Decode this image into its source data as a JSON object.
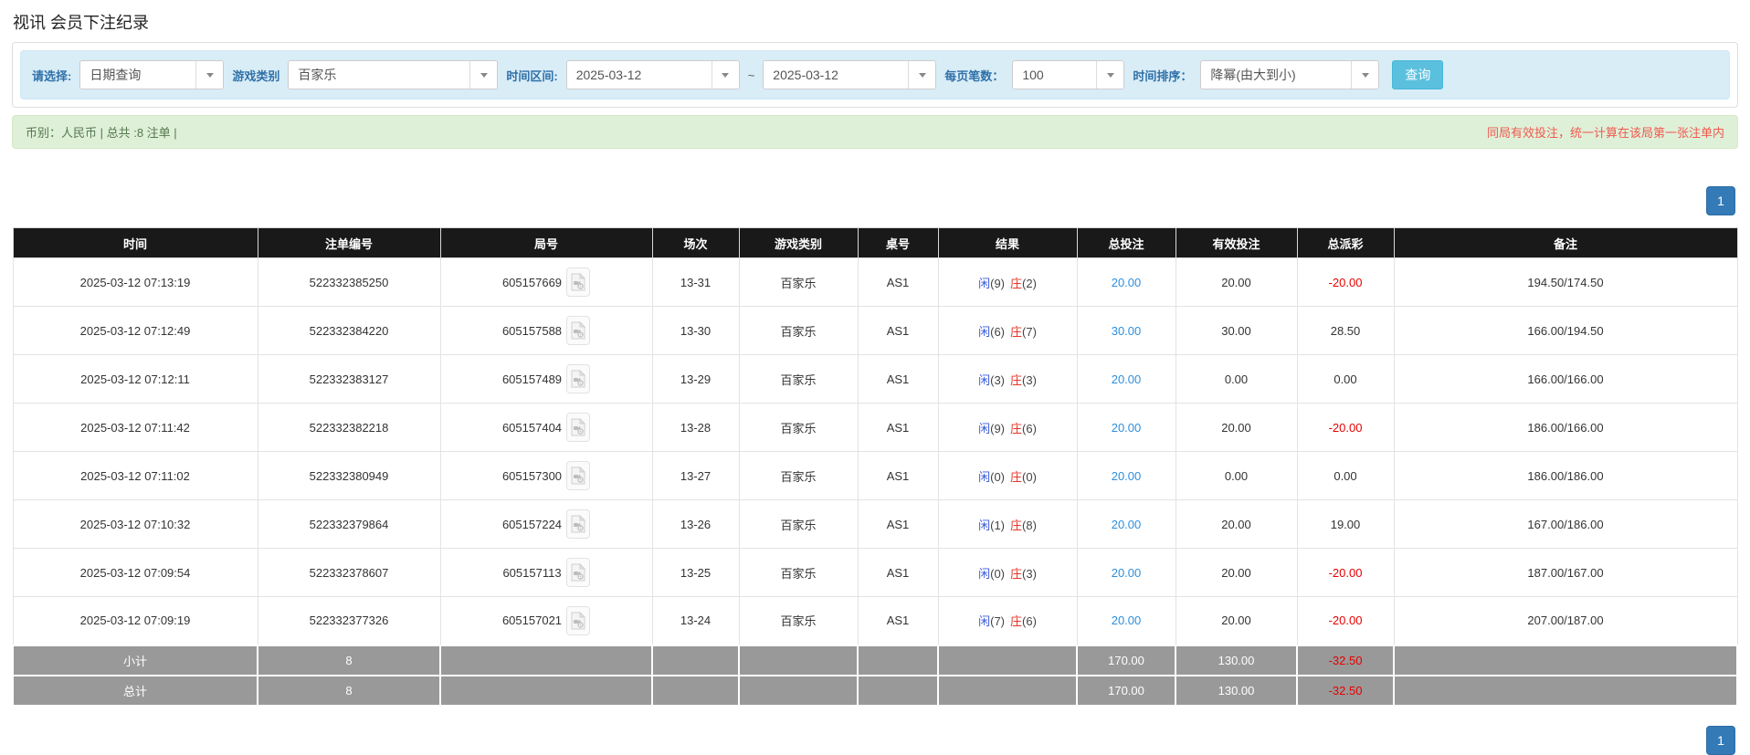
{
  "page": {
    "title": "视讯 会员下注纪录"
  },
  "filters": {
    "select": {
      "label": "请选择:",
      "value": "日期查询"
    },
    "game_type": {
      "label": "游戏类别",
      "value": "百家乐"
    },
    "time_range": {
      "label": "时间区间:",
      "from": "2025-03-12",
      "separator": "~",
      "to": "2025-03-12"
    },
    "page_size": {
      "label": "每页笔数：",
      "value": "100"
    },
    "time_sort": {
      "label": "时间排序：",
      "value": "降幂(由大到小)"
    },
    "search_button": "查询"
  },
  "summary": {
    "currency_total": "币别：人民币 | 总共 :8 注单 |",
    "note": "同局有效投注，统一计算在该局第一张注单内"
  },
  "pagination": {
    "current_page": "1"
  },
  "icons": {
    "dropdown": "chevron-down-icon",
    "round_video": "video-file-icon"
  },
  "colors": {
    "header_bg": "#191919",
    "filter_bg": "#d9edf7",
    "summary_bg": "#dff0d8",
    "search_button": "#5bc0de",
    "page_button": "#337ab7",
    "footer_bg": "#999999",
    "negative_red": "#e60000",
    "note_red": "#f0594f",
    "player_blue": "#3b5bdb",
    "banker_red": "#e53528",
    "link_blue": "#2d8fdd"
  },
  "table": {
    "headers": [
      "时间",
      "注单编号",
      "局号",
      "场次",
      "游戏类别",
      "桌号",
      "结果",
      "总投注",
      "有效投注",
      "总派彩",
      "备注"
    ],
    "rows": [
      {
        "time": "2025-03-12 07:13:19",
        "bet_id": "522332385250",
        "round_id": "605157669",
        "session": "13-31",
        "game_type": "百家乐",
        "table_id": "AS1",
        "player_label": "闲",
        "player_score": "(9)",
        "banker_label": "庄",
        "banker_score": "(2)",
        "total_bet": "20.00",
        "valid_bet": "20.00",
        "payout": "-20.00",
        "remark": "194.50/174.50"
      },
      {
        "time": "2025-03-12 07:12:49",
        "bet_id": "522332384220",
        "round_id": "605157588",
        "session": "13-30",
        "game_type": "百家乐",
        "table_id": "AS1",
        "player_label": "闲",
        "player_score": "(6)",
        "banker_label": "庄",
        "banker_score": "(7)",
        "total_bet": "30.00",
        "valid_bet": "30.00",
        "payout": "28.50",
        "remark": "166.00/194.50"
      },
      {
        "time": "2025-03-12 07:12:11",
        "bet_id": "522332383127",
        "round_id": "605157489",
        "session": "13-29",
        "game_type": "百家乐",
        "table_id": "AS1",
        "player_label": "闲",
        "player_score": "(3)",
        "banker_label": "庄",
        "banker_score": "(3)",
        "total_bet": "20.00",
        "valid_bet": "0.00",
        "payout": "0.00",
        "remark": "166.00/166.00"
      },
      {
        "time": "2025-03-12 07:11:42",
        "bet_id": "522332382218",
        "round_id": "605157404",
        "session": "13-28",
        "game_type": "百家乐",
        "table_id": "AS1",
        "player_label": "闲",
        "player_score": "(9)",
        "banker_label": "庄",
        "banker_score": "(6)",
        "total_bet": "20.00",
        "valid_bet": "20.00",
        "payout": "-20.00",
        "remark": "186.00/166.00"
      },
      {
        "time": "2025-03-12 07:11:02",
        "bet_id": "522332380949",
        "round_id": "605157300",
        "session": "13-27",
        "game_type": "百家乐",
        "table_id": "AS1",
        "player_label": "闲",
        "player_score": "(0)",
        "banker_label": "庄",
        "banker_score": "(0)",
        "total_bet": "20.00",
        "valid_bet": "0.00",
        "payout": "0.00",
        "remark": "186.00/186.00"
      },
      {
        "time": "2025-03-12 07:10:32",
        "bet_id": "522332379864",
        "round_id": "605157224",
        "session": "13-26",
        "game_type": "百家乐",
        "table_id": "AS1",
        "player_label": "闲",
        "player_score": "(1)",
        "banker_label": "庄",
        "banker_score": "(8)",
        "total_bet": "20.00",
        "valid_bet": "20.00",
        "payout": "19.00",
        "remark": "167.00/186.00"
      },
      {
        "time": "2025-03-12 07:09:54",
        "bet_id": "522332378607",
        "round_id": "605157113",
        "session": "13-25",
        "game_type": "百家乐",
        "table_id": "AS1",
        "player_label": "闲",
        "player_score": "(0)",
        "banker_label": "庄",
        "banker_score": "(3)",
        "total_bet": "20.00",
        "valid_bet": "20.00",
        "payout": "-20.00",
        "remark": "187.00/167.00"
      },
      {
        "time": "2025-03-12 07:09:19",
        "bet_id": "522332377326",
        "round_id": "605157021",
        "session": "13-24",
        "game_type": "百家乐",
        "table_id": "AS1",
        "player_label": "闲",
        "player_score": "(7)",
        "banker_label": "庄",
        "banker_score": "(6)",
        "total_bet": "20.00",
        "valid_bet": "20.00",
        "payout": "-20.00",
        "remark": "207.00/187.00"
      }
    ],
    "subtotal": {
      "label": "小计",
      "count": "8",
      "total_bet": "170.00",
      "valid_bet": "130.00",
      "payout": "-32.50"
    },
    "total": {
      "label": "总计",
      "count": "8",
      "total_bet": "170.00",
      "valid_bet": "130.00",
      "payout": "-32.50"
    }
  }
}
